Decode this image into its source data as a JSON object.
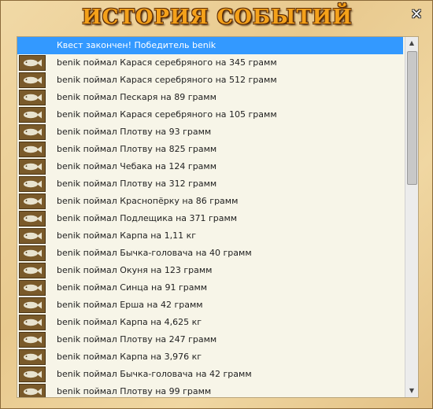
{
  "window": {
    "title": "ИСТОРИЯ СОБЫТИЙ",
    "close_icon": "close-icon"
  },
  "events": [
    {
      "text": "Квест закончен! Победитель benik",
      "selected": true,
      "icon": ""
    },
    {
      "text": "benik поймал Карася серебряного на 345 грамм",
      "icon": "fish-icon"
    },
    {
      "text": "benik поймал Карася серебряного на 512 грамм",
      "icon": "fish-icon"
    },
    {
      "text": "benik поймал Пескаря на 89 грамм",
      "icon": "fish-icon"
    },
    {
      "text": "benik поймал Карася серебряного на 105 грамм",
      "icon": "fish-icon"
    },
    {
      "text": "benik поймал Плотву на 93 грамм",
      "icon": "fish-icon"
    },
    {
      "text": "benik поймал Плотву на 825 грамм",
      "icon": "fish-icon"
    },
    {
      "text": "benik поймал Чебака на 124 грамм",
      "icon": "fish-icon"
    },
    {
      "text": "benik поймал Плотву на 312 грамм",
      "icon": "fish-icon"
    },
    {
      "text": "benik поймал Краснопёрку на 86 грамм",
      "icon": "fish-icon"
    },
    {
      "text": "benik поймал Подлещика на 371 грамм",
      "icon": "fish-icon"
    },
    {
      "text": "benik поймал Карпа на 1,11 кг",
      "icon": "fish-icon"
    },
    {
      "text": "benik поймал Бычка-головача на 40 грамм",
      "icon": "fish-icon"
    },
    {
      "text": "benik поймал Окуня на 123 грамм",
      "icon": "fish-icon"
    },
    {
      "text": "benik поймал Синца на 91 грамм",
      "icon": "fish-icon"
    },
    {
      "text": "benik поймал Ерша на 42 грамм",
      "icon": "fish-icon"
    },
    {
      "text": "benik поймал Карпа на 4,625 кг",
      "icon": "fish-icon"
    },
    {
      "text": "benik поймал Плотву на 247 грамм",
      "icon": "fish-icon"
    },
    {
      "text": "benik поймал Карпа на 3,976 кг",
      "icon": "fish-icon"
    },
    {
      "text": "benik поймал Бычка-головача на 42 грамм",
      "icon": "fish-icon"
    },
    {
      "text": "benik поймал Плотву на 99 грамм",
      "icon": "fish-icon"
    }
  ],
  "scrollbar": {
    "up_icon": "scroll-up-arrow-icon",
    "down_icon": "scroll-down-arrow-icon"
  },
  "colors": {
    "selected_bg": "#3399ff",
    "title": "#f4a11a",
    "list_bg": "#f7f5e8"
  }
}
